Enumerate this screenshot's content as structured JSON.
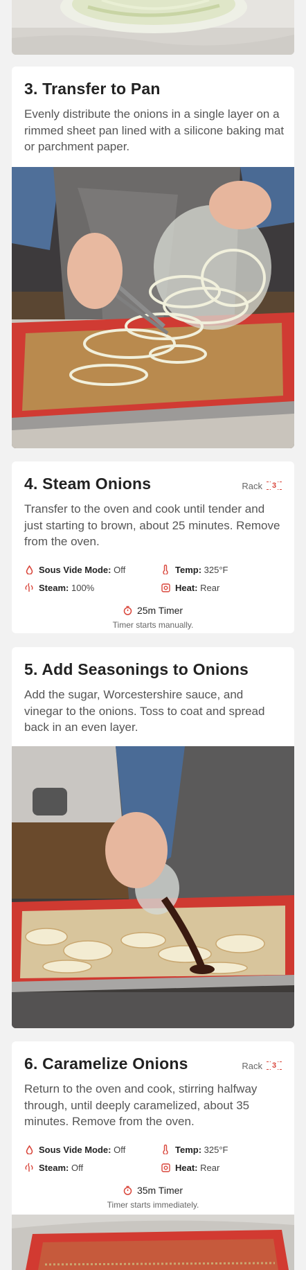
{
  "colors": {
    "accent": "#d9463b",
    "background": "#f2f2f2",
    "card": "#ffffff",
    "body_text": "#555555"
  },
  "top_image": {
    "alt_icon": "onions-in-bowl-photo"
  },
  "step3": {
    "title": "3. Transfer to Pan",
    "text": "Evenly distribute the onions in a single layer on a rimmed sheet pan lined with a silicone baking mat or parchment paper.",
    "image": "onions-onto-sheet-pan-photo"
  },
  "step4": {
    "title": "4. Steam Onions",
    "rack_label": "Rack",
    "rack_number": "3",
    "text": "Transfer to the oven and cook until tender and just starting to brown, about 25 minutes. Remove from the oven.",
    "settings": {
      "sous_vide_label": "Sous Vide Mode:",
      "sous_vide_value": "Off",
      "temp_label": "Temp:",
      "temp_value": "325°F",
      "steam_label": "Steam:",
      "steam_value": "100%",
      "heat_label": "Heat:",
      "heat_value": "Rear"
    },
    "timer": "25m Timer",
    "timer_note": "Timer starts manually."
  },
  "step5": {
    "title": "5. Add Seasonings to Onions",
    "text": "Add the sugar, Worcestershire sauce, and vinegar to the onions. Toss to coat and spread back in an even layer.",
    "image": "pouring-sauce-photo"
  },
  "step6": {
    "title": "6. Caramelize Onions",
    "rack_label": "Rack",
    "rack_number": "3",
    "text": "Return to the oven and cook, stirring halfway through, until deeply caramelized, about 35 minutes. Remove from the oven.",
    "settings": {
      "sous_vide_label": "Sous Vide Mode:",
      "sous_vide_value": "Off",
      "temp_label": "Temp:",
      "temp_value": "325°F",
      "steam_label": "Steam:",
      "steam_value": "Off",
      "heat_label": "Heat:",
      "heat_value": "Rear"
    },
    "timer": "35m Timer",
    "timer_note": "Timer starts immediately.",
    "image": "caramelized-onions-photo"
  }
}
